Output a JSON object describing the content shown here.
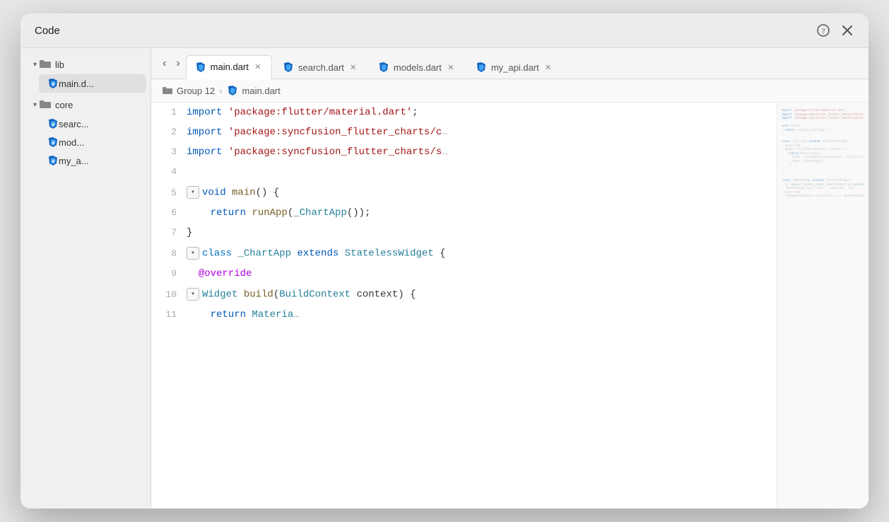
{
  "window": {
    "title": "Code",
    "help_icon": "?",
    "close_icon": "✕"
  },
  "sidebar": {
    "lib_label": "lib",
    "main_dart_label": "main.d...",
    "core_label": "core",
    "search_label": "searc...",
    "models_label": "mod...",
    "my_api_label": "my_a..."
  },
  "tabs": [
    {
      "label": "main.dart",
      "active": true
    },
    {
      "label": "search.dart",
      "active": false
    },
    {
      "label": "models.dart",
      "active": false
    },
    {
      "label": "my_api.dart",
      "active": false
    }
  ],
  "breadcrumb": {
    "group": "Group 12",
    "file": "main.dart"
  },
  "code_lines": [
    {
      "num": 1,
      "tokens": [
        {
          "t": "kw",
          "v": "import "
        },
        {
          "t": "str",
          "v": "'package:flutter/material.dart'"
        },
        {
          "t": "punct",
          "v": ";"
        }
      ]
    },
    {
      "num": 2,
      "tokens": [
        {
          "t": "kw",
          "v": "import "
        },
        {
          "t": "str",
          "v": "'package:syncfusion_flutter_charts/c…'"
        }
      ]
    },
    {
      "num": 3,
      "tokens": [
        {
          "t": "kw",
          "v": "import "
        },
        {
          "t": "str",
          "v": "'package:syncfusion_flutter_charts/s…'"
        }
      ]
    },
    {
      "num": 4,
      "tokens": []
    },
    {
      "num": 5,
      "tokens": [
        {
          "t": "fold",
          "v": "▾"
        },
        {
          "t": "kw",
          "v": "void "
        },
        {
          "t": "fn",
          "v": "main"
        },
        {
          "t": "punct",
          "v": "() {"
        }
      ]
    },
    {
      "num": 6,
      "tokens": [
        {
          "t": "plain",
          "v": "    "
        },
        {
          "t": "kw",
          "v": "return "
        },
        {
          "t": "fn",
          "v": "runApp"
        },
        {
          "t": "punct",
          "v": "("
        },
        {
          "t": "type",
          "v": "_ChartApp"
        },
        {
          "t": "punct",
          "v": "());"
        }
      ]
    },
    {
      "num": 7,
      "tokens": [
        {
          "t": "punct",
          "v": "}"
        }
      ]
    },
    {
      "num": 8,
      "tokens": [
        {
          "t": "fold",
          "v": "▾"
        },
        {
          "t": "kw2",
          "v": "class "
        },
        {
          "t": "type",
          "v": "_ChartApp "
        },
        {
          "t": "kw",
          "v": "extends "
        },
        {
          "t": "type",
          "v": "StatelessWidget "
        },
        {
          "t": "punct",
          "v": "{"
        }
      ]
    },
    {
      "num": 9,
      "tokens": [
        {
          "t": "plain",
          "v": "  "
        },
        {
          "t": "decorator",
          "v": "@override"
        }
      ]
    },
    {
      "num": 10,
      "tokens": [
        {
          "t": "fold",
          "v": "▾"
        },
        {
          "t": "type",
          "v": "Widget "
        },
        {
          "t": "fn",
          "v": "build"
        },
        {
          "t": "punct",
          "v": "("
        },
        {
          "t": "type",
          "v": "BuildContext "
        },
        {
          "t": "plain",
          "v": "context"
        },
        {
          "t": "punct",
          "v": ") {"
        }
      ]
    },
    {
      "num": 11,
      "tokens": [
        {
          "t": "plain",
          "v": "    "
        },
        {
          "t": "kw",
          "v": "return "
        },
        {
          "t": "type",
          "v": "Materia"
        }
      ]
    }
  ],
  "minimap_lines": [
    "import 'package:flutter/material.dart';",
    "import 'package:syncfusion_flutter_charts/charts.dart';",
    "import 'package:syncfusion_flutter_charts/sparkcharts.dart';",
    "",
    "void main() {",
    "  return runApp(_ChartApp());",
    "}",
    "",
    "class _ChartApp extends StatelessWidget {",
    "  @override",
    "  Widget build(BuildContext context) {",
    "    return MaterialApp(",
    "      theme: ThemeData(primarySwatch: Colors.blue),",
    "      home: _MyHomePage(),",
    "    );",
    "  }",
    "}",
    "",
    "class _MyHomePage extends StatefulWidget {",
    "  // ignore: prefer_const_constructors_in_immutables",
    "  _MyHomePage({Key? key}) : super(key: key);",
    "  @override",
    "  _MyHomePageState createState() => _MyHomePageState();",
    "}"
  ]
}
